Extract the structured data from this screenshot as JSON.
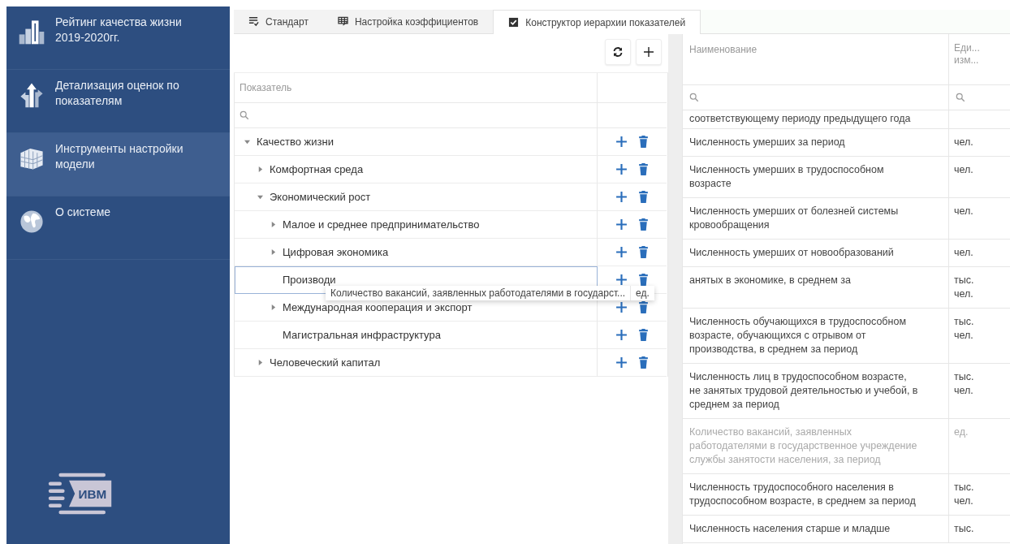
{
  "sidebar": {
    "items": [
      {
        "kind": "chart",
        "label": "Рейтинг качества жизни 2019-2020гг.",
        "selected": false
      },
      {
        "kind": "arrows",
        "label": "Детализация оценок по показателям",
        "selected": false
      },
      {
        "kind": "grid",
        "label": "Инструменты настройки модели",
        "selected": true
      },
      {
        "kind": "globe",
        "label": "О системе",
        "selected": false
      }
    ],
    "logo": {
      "text": "ИВМ"
    }
  },
  "tabs": [
    {
      "kind": "list",
      "label": "Стандарт",
      "selected": false
    },
    {
      "kind": "table",
      "label": "Настройка коэффициентов",
      "selected": false
    },
    {
      "kind": "check",
      "label": "Конструктор иерархии показателей",
      "selected": true
    }
  ],
  "tree": {
    "column": "Показатель",
    "items": [
      {
        "label": "Качество жизни",
        "kind": "branch",
        "expanded": true,
        "children": [
          {
            "label": "Комфортная среда",
            "kind": "branch",
            "expanded": false
          },
          {
            "label": "Экономический рост",
            "kind": "branch",
            "expanded": true,
            "children": [
              {
                "label": "Малое и среднее предпринимательство",
                "kind": "branch",
                "expanded": false
              },
              {
                "label": "Цифровая экономика",
                "kind": "branch",
                "expanded": false
              },
              {
                "label": "Производи",
                "kind": "leaf",
                "selected": true
              },
              {
                "label": "Международная кооперация и экспорт",
                "kind": "branch",
                "expanded": false
              },
              {
                "label": "Магистральная инфраструктура",
                "kind": "leaf",
                "selected": false
              }
            ]
          },
          {
            "label": "Человеческий капитал",
            "kind": "branch",
            "expanded": false
          }
        ]
      }
    ]
  },
  "drag_ghost": {
    "name": "Количество вакансий, заявленных работодателями в государст...",
    "unit": "ед."
  },
  "indicators": {
    "columns": [
      "Наименование",
      "Еди... изм..."
    ],
    "rows": [
      {
        "name": "соответствующему периоду предыдущего года",
        "unit": "",
        "disabled": false
      },
      {
        "name": "Численность умерших за период",
        "unit": "чел.",
        "disabled": false
      },
      {
        "name": "Численность умерших в трудоспособном возрасте",
        "unit": "чел.",
        "disabled": false
      },
      {
        "name": "Численность умерших от болезней системы кровообращения",
        "unit": "чел.",
        "disabled": false
      },
      {
        "name": "Численность умерших от новообразований",
        "unit": "чел.",
        "disabled": false
      },
      {
        "name": "анятых в экономике, в среднем за",
        "unit": "тыс. чел.",
        "disabled": false
      },
      {
        "name": "Численность обучающихся в трудоспособном возрасте, обучающихся с отрывом от производства, в среднем за период",
        "unit": "тыс. чел.",
        "disabled": false
      },
      {
        "name": "Численность лиц в трудоспособном возрасте, не занятых трудовой деятельностью и учебой, в среднем за период",
        "unit": "тыс. чел.",
        "disabled": false
      },
      {
        "name": "Количество вакансий, заявленных работодателями в государственное учреждение службы занятости населения, за период",
        "unit": "ед.",
        "disabled": true
      },
      {
        "name": "Численность трудоспособного населения в трудоспособном возрасте, в среднем за период",
        "unit": "тыс. чел.",
        "disabled": false
      },
      {
        "name": "Численность населения старше и младше",
        "unit": "тыс.",
        "disabled": false
      }
    ]
  }
}
